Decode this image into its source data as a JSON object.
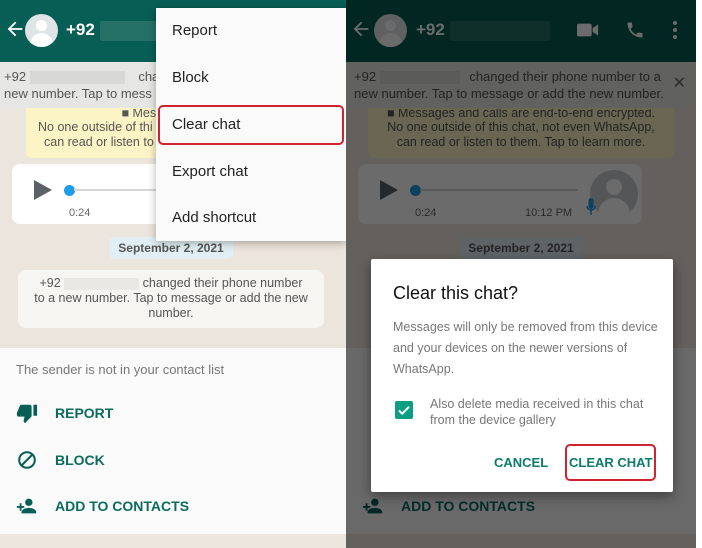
{
  "left": {
    "header": {
      "title_prefix": "+92"
    },
    "banner": {
      "line1_prefix": "+92",
      "line1_suffix": "change",
      "line2": "new number. Tap to mess"
    },
    "encryption_notice": {
      "line1": "■ Messages and ca",
      "line2": "No one outside of thi",
      "line3": "can read or listen to"
    },
    "voice_message": {
      "duration": "0:24"
    },
    "date_chip": "September 2, 2021",
    "system_message": {
      "prefix": "+92",
      "line1_suffix": "changed their phone number",
      "line2": "to a new number. Tap to message or add the new",
      "line3": "number."
    },
    "contact_card": {
      "notice": "The sender is not in your contact list",
      "actions": [
        {
          "label": "REPORT",
          "icon": "thumbs-down-icon"
        },
        {
          "label": "BLOCK",
          "icon": "block-icon"
        },
        {
          "label": "ADD TO CONTACTS",
          "icon": "add-person-icon"
        }
      ]
    },
    "overflow_menu": {
      "items": [
        "Report",
        "Block",
        "Clear chat",
        "Export chat",
        "Add shortcut"
      ],
      "highlighted": "Clear chat"
    }
  },
  "right": {
    "header": {
      "title_prefix": "+92",
      "icons": [
        "video-call-icon",
        "voice-call-icon",
        "more-options-icon"
      ]
    },
    "banner": {
      "line1_prefix": "+92",
      "line1_suffix": "changed their phone number to a",
      "line2": "new number. Tap to message or add the new number."
    },
    "encryption_notice": {
      "line1": "■ Messages and calls are end-to-end encrypted.",
      "line2": "No one outside of this chat, not even WhatsApp,",
      "line3": "can read or listen to them. Tap to learn more."
    },
    "voice_message": {
      "duration": "0:24",
      "time": "10:12 PM"
    },
    "date_chip": "September 2, 2021",
    "dialog": {
      "title": "Clear this chat?",
      "body": "Messages will only be removed from this device and your devices on the newer versions of WhatsApp.",
      "checkbox_label": "Also delete media received in this chat from the device gallery",
      "checkbox_checked": true,
      "cancel_label": "CANCEL",
      "confirm_label": "CLEAR CHAT"
    },
    "partial_action_label": "ADD TO CONTACTS"
  },
  "colors": {
    "appbar": "#075e54",
    "accent": "#0b7c6b",
    "highlight_border": "#d0232f",
    "checkbox": "#0b9e80"
  }
}
